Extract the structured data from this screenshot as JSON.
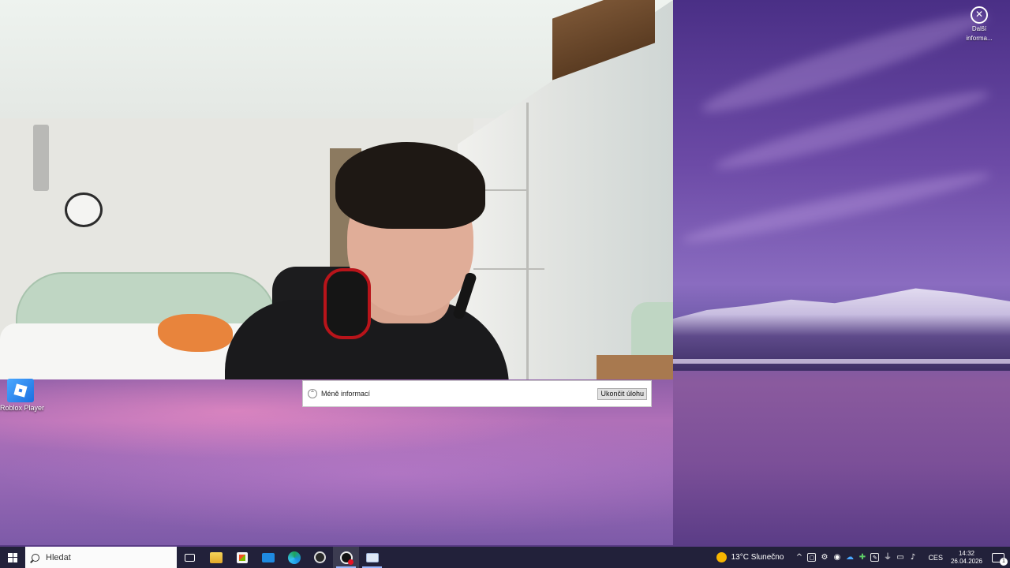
{
  "desktop": {
    "icons": [
      {
        "label": "Roblox Player",
        "icon": "roblox-icon"
      }
    ],
    "widget": {
      "label_line1": "Další",
      "label_line2": "informa...",
      "icon": "close-circle-icon"
    }
  },
  "camera_window": {
    "content": "webcam-feed"
  },
  "task_manager": {
    "toggle_label": "Méně informací",
    "end_task_label": "Ukončit úlohu"
  },
  "taskbar": {
    "search_placeholder": "Hledat",
    "apps": [
      {
        "name": "task-view",
        "icon": "task-view-icon"
      },
      {
        "name": "file-explorer",
        "icon": "folder-icon"
      },
      {
        "name": "microsoft-store",
        "icon": "store-icon"
      },
      {
        "name": "mail",
        "icon": "mail-icon"
      },
      {
        "name": "edge",
        "icon": "edge-icon"
      },
      {
        "name": "recorder",
        "icon": "record-icon"
      },
      {
        "name": "camera",
        "icon": "camera-icon",
        "state": "active"
      },
      {
        "name": "task-manager",
        "icon": "task-manager-icon",
        "state": "running"
      }
    ],
    "weather": {
      "text": "13°C Slunečno",
      "icon": "sun-icon"
    },
    "language": "CES",
    "time": "14:32",
    "date": "26.04.2026",
    "notifications_count": "1"
  },
  "colors": {
    "taskbar_bg": "#22213a",
    "wallpaper_purple": "#6c4aa6",
    "accent_blue": "#1b6fe0"
  }
}
